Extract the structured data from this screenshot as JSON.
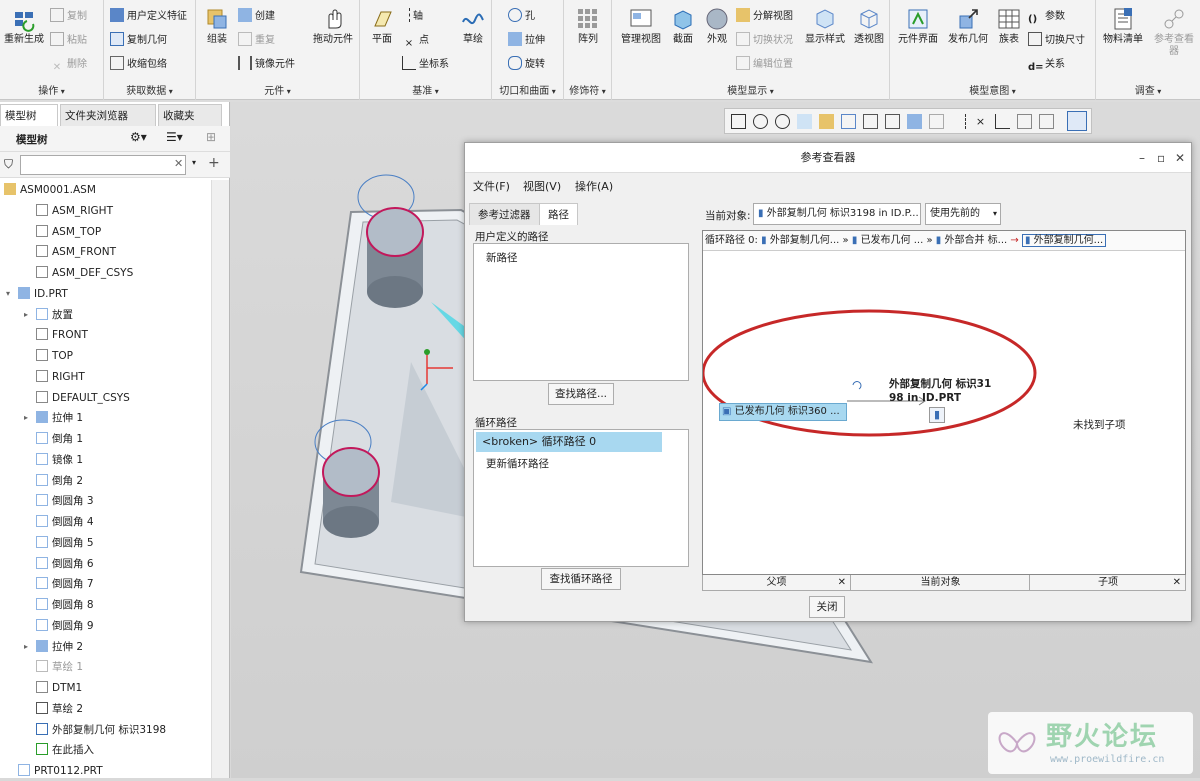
{
  "ribbon": {
    "groups": [
      {
        "label": "操作",
        "big": [
          {
            "label": "重新生成"
          }
        ],
        "small": [
          {
            "label": "复制",
            "dis": true
          },
          {
            "label": "粘贴",
            "dis": true
          },
          {
            "label": "删除",
            "dis": true
          }
        ]
      },
      {
        "label": "获取数据",
        "small": [
          {
            "label": "用户定义特征"
          },
          {
            "label": "复制几何"
          },
          {
            "label": "收缩包络"
          }
        ]
      },
      {
        "label": "元件",
        "big": [
          {
            "label": "组装"
          },
          {
            "label": "拖动元件"
          }
        ],
        "small": [
          {
            "label": "创建"
          },
          {
            "label": "重复",
            "dis": true
          },
          {
            "label": "镜像元件"
          }
        ]
      },
      {
        "label": "基准",
        "big": [
          {
            "label": "平面"
          },
          {
            "label": "草绘"
          }
        ],
        "small": [
          {
            "label": "轴"
          },
          {
            "label": "点"
          },
          {
            "label": "坐标系"
          }
        ]
      },
      {
        "label": "切口和曲面",
        "small": [
          {
            "label": "孔"
          },
          {
            "label": "拉伸"
          },
          {
            "label": "旋转"
          }
        ]
      },
      {
        "label": "修饰符",
        "big": [
          {
            "label": "阵列"
          }
        ]
      },
      {
        "label": "模型显示",
        "big": [
          {
            "label": "管理视图"
          },
          {
            "label": "截面"
          },
          {
            "label": "外观"
          },
          {
            "label": "显示样式"
          },
          {
            "label": "透视图"
          }
        ],
        "small": [
          {
            "label": "分解视图"
          },
          {
            "label": "切换状况",
            "dis": true
          },
          {
            "label": "编辑位置",
            "dis": true
          }
        ]
      },
      {
        "label": "模型意图",
        "big": [
          {
            "label": "元件界面"
          },
          {
            "label": "发布几何"
          },
          {
            "label": "族表"
          }
        ],
        "small": [
          {
            "label": "参数"
          },
          {
            "label": "切换尺寸"
          },
          {
            "label": "关系"
          }
        ]
      },
      {
        "label": "调查",
        "big": [
          {
            "label": "物料清单"
          },
          {
            "label": "参考查看器"
          }
        ]
      }
    ]
  },
  "panel": {
    "tabs": [
      "模型树",
      "文件夹浏览器",
      "收藏夹"
    ],
    "tree_title": "模型树",
    "search_placeholder": "",
    "nodes": [
      {
        "label": "ASM0001.ASM"
      },
      {
        "label": "ASM_RIGHT"
      },
      {
        "label": "ASM_TOP"
      },
      {
        "label": "ASM_FRONT"
      },
      {
        "label": "ASM_DEF_CSYS"
      },
      {
        "label": "ID.PRT"
      },
      {
        "label": "放置"
      },
      {
        "label": "FRONT"
      },
      {
        "label": "TOP"
      },
      {
        "label": "RIGHT"
      },
      {
        "label": "DEFAULT_CSYS"
      },
      {
        "label": "拉伸 1"
      },
      {
        "label": "倒角 1"
      },
      {
        "label": "镜像 1"
      },
      {
        "label": "倒角 2"
      },
      {
        "label": "倒圆角 3"
      },
      {
        "label": "倒圆角 4"
      },
      {
        "label": "倒圆角 5"
      },
      {
        "label": "倒圆角 6"
      },
      {
        "label": "倒圆角 7"
      },
      {
        "label": "倒圆角 8"
      },
      {
        "label": "倒圆角 9"
      },
      {
        "label": "拉伸 2"
      },
      {
        "label": "草绘 1"
      },
      {
        "label": "DTM1"
      },
      {
        "label": "草绘 2"
      },
      {
        "label": "外部复制几何 标识3198"
      },
      {
        "label": "在此插入"
      },
      {
        "label": "PRT0112.PRT"
      }
    ]
  },
  "dialog": {
    "title": "参考查看器",
    "menu": [
      "文件(F)",
      "视图(V)",
      "操作(A)"
    ],
    "tabs": [
      "参考过滤器",
      "路径"
    ],
    "user_paths_label": "用户定义的路径",
    "new_path": "新路径",
    "find_path_btn": "查找路径...",
    "loop_label": "循环路径",
    "loop_items": [
      "<broken> 循环路径 0",
      "更新循环路径"
    ],
    "find_loop_btn": "查找循环路径",
    "current_obj_label": "当前对象:",
    "current_obj_value": "外部复制几何 标识3198 in ID.P...",
    "use_prev": "使用先前的",
    "pathbar": {
      "prefix": "循环路径 0:",
      "items": [
        "外部复制几何...",
        "已发布几何 ...",
        "外部合并 标...",
        "外部复制几何..."
      ]
    },
    "graph": {
      "node_title": "外部复制几何 标识3198 in ID.PRT",
      "parent_node": "已发布几何 标识360 ...",
      "no_children": "未找到子项"
    },
    "col_labels": [
      "父项",
      "当前对象",
      "子项"
    ],
    "close_btn": "关闭"
  },
  "watermark": {
    "brand": "野火论坛",
    "url": "www.proewildfire.cn"
  }
}
